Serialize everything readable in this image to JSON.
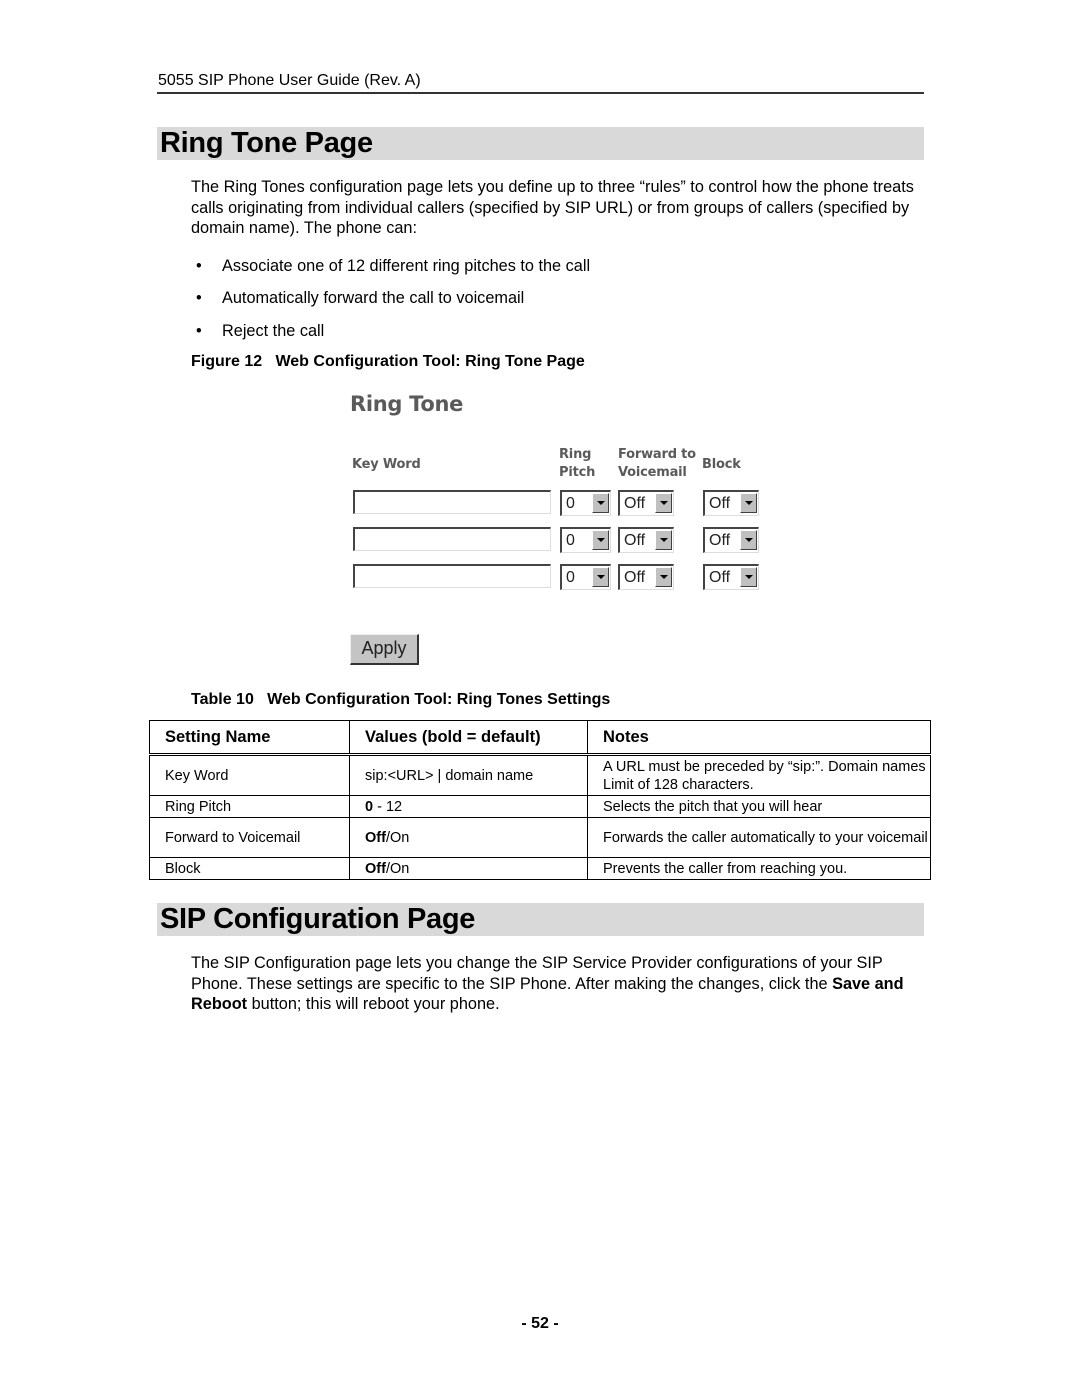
{
  "running_header": "5055 SIP Phone User Guide (Rev. A)",
  "sections": [
    {
      "title": "Ring Tone Page",
      "intro": "The Ring Tones configuration page lets you define up to three “rules” to control how the phone treats calls originating from individual callers (specified by SIP URL) or from groups of callers (specified by domain name). The phone can:",
      "bullets": [
        "Associate one of 12 different ring pitches to the call",
        "Automatically forward the call to voicemail",
        "Reject the call"
      ],
      "figure_caption": "Figure 12   Web Configuration Tool: Ring Tone Page",
      "table_caption": "Table 10   Web Configuration Tool: Ring Tones Settings"
    },
    {
      "title": "SIP Configuration Page",
      "intro_part1": "The SIP Configuration page lets you change the SIP Service Provider configurations of your SIP Phone. These settings are specific to the SIP Phone.  After making the changes, click the ",
      "intro_bold": "Save and Reboot",
      "intro_part2": " button; this will reboot your phone."
    }
  ],
  "ring_tone_form": {
    "title": "Ring Tone",
    "headers": {
      "key_word": "Key Word",
      "ring_pitch_1": "Ring",
      "ring_pitch_2": "Pitch",
      "forward_1": "Forward to",
      "forward_2": "Voicemail",
      "block": "Block"
    },
    "rows": [
      {
        "key_word": "",
        "ring_pitch": "0",
        "forward": "Off",
        "block": "Off"
      },
      {
        "key_word": "",
        "ring_pitch": "0",
        "forward": "Off",
        "block": "Off"
      },
      {
        "key_word": "",
        "ring_pitch": "0",
        "forward": "Off",
        "block": "Off"
      }
    ],
    "apply_label": "Apply"
  },
  "settings_table": {
    "headers": [
      "Setting Name",
      "Values (bold = default)",
      "Notes"
    ],
    "rows": [
      {
        "name": "Key Word",
        "value_bold": "",
        "value_rest": "sip:<URL> | domain name",
        "notes": "A URL must be preceded by “sip:”. Domain names Limit of 128 characters."
      },
      {
        "name": "Ring Pitch",
        "value_bold": "0",
        "value_rest": " - 12",
        "notes": "Selects the pitch that you will hear"
      },
      {
        "name": "Forward to Voicemail",
        "value_bold": "Off",
        "value_rest": "/On",
        "notes": "Forwards the caller automatically to your voicemail"
      },
      {
        "name": "Block",
        "value_bold": "Off",
        "value_rest": "/On",
        "notes": "Prevents the caller from reaching you."
      }
    ]
  },
  "page_number": "- 52 -"
}
